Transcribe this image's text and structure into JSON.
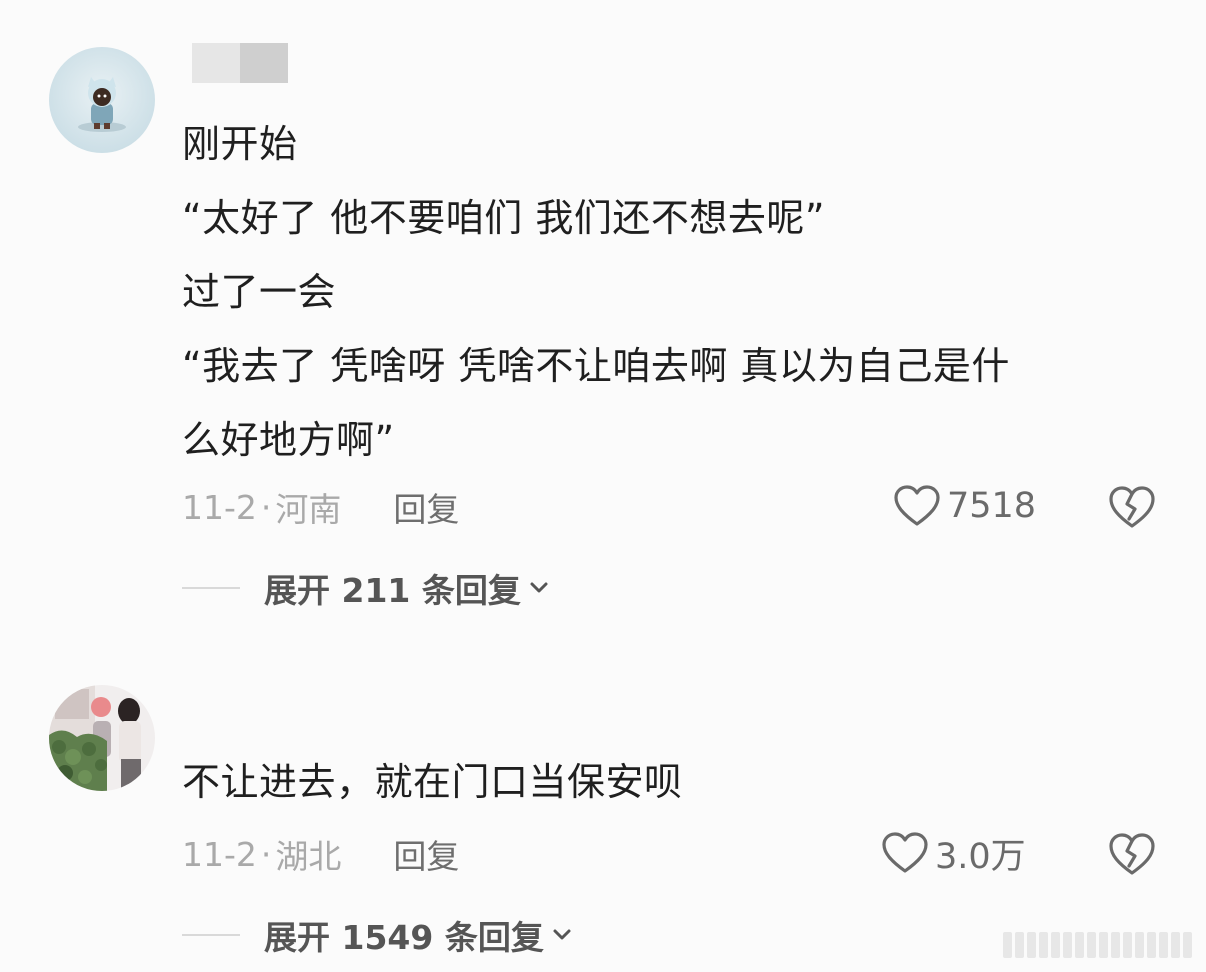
{
  "comments": [
    {
      "lines": [
        "刚开始",
        "“太好了 他不要咱们 我们还不想去呢”",
        "过了一会",
        "“我去了 凭啥呀 凭啥不让咱去啊 真以为自己是什",
        "么好地方啊”"
      ],
      "date": "11-2",
      "separator": "·",
      "location": "河南",
      "reply_label": "回复",
      "likes": "7518",
      "expand_label": "展开 211 条回复"
    },
    {
      "lines": [
        "不让进去，就在门口当保安呗"
      ],
      "date": "11-2",
      "separator": "·",
      "location": "湖北",
      "reply_label": "回复",
      "likes": "3.0万",
      "expand_label": "展开 1549 条回复"
    }
  ],
  "icons": {
    "like": "heart-outline-icon",
    "dislike": "broken-heart-icon",
    "expand": "chevron-down-icon"
  },
  "colors": {
    "background": "#fbfbfb",
    "text_primary": "#1f1f1f",
    "text_secondary": "#a9a9a9",
    "action_text": "#6e6e6e",
    "icon_gray": "#6a6a6a"
  }
}
